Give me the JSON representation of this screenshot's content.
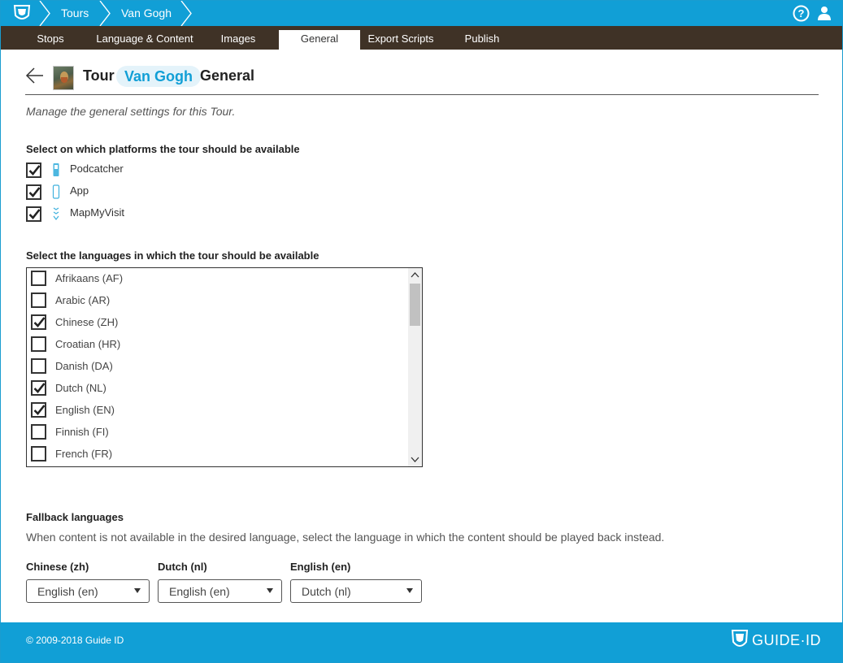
{
  "breadcrumb": {
    "items": [
      "Tours",
      "Van Gogh"
    ]
  },
  "nav": {
    "tabs": [
      {
        "label": "Stops"
      },
      {
        "label": "Language & Content"
      },
      {
        "label": "Images"
      },
      {
        "label": "General",
        "active": true
      },
      {
        "label": "Export Scripts"
      },
      {
        "label": "Publish"
      }
    ]
  },
  "header": {
    "title_prefix": "Tour",
    "tour_name": "Van Gogh",
    "title_suffix": "General",
    "subtitle": "Manage the general settings for this Tour."
  },
  "platforms": {
    "heading": "Select on which platforms the tour should be available",
    "items": [
      {
        "label": "Podcatcher",
        "checked": true,
        "icon": "podcatcher-icon"
      },
      {
        "label": "App",
        "checked": true,
        "icon": "phone-icon"
      },
      {
        "label": "MapMyVisit",
        "checked": true,
        "icon": "map-pin-icon"
      }
    ]
  },
  "languages": {
    "heading": "Select the languages in which the tour should be available",
    "items": [
      {
        "label": "Afrikaans (AF)",
        "checked": false
      },
      {
        "label": "Arabic (AR)",
        "checked": false
      },
      {
        "label": "Chinese (ZH)",
        "checked": true
      },
      {
        "label": "Croatian (HR)",
        "checked": false
      },
      {
        "label": "Danish (DA)",
        "checked": false
      },
      {
        "label": "Dutch (NL)",
        "checked": true
      },
      {
        "label": "English (EN)",
        "checked": true
      },
      {
        "label": "Finnish (FI)",
        "checked": false
      },
      {
        "label": "French (FR)",
        "checked": false
      }
    ]
  },
  "fallback": {
    "heading": "Fallback languages",
    "description": "When content is not available in the desired language, select the language in which the content should be played back instead.",
    "selects": [
      {
        "label": "Chinese (zh)",
        "value": "English (en)"
      },
      {
        "label": "Dutch (nl)",
        "value": "English (en)"
      },
      {
        "label": "English (en)",
        "value": "Dutch (nl)"
      }
    ]
  },
  "footer": {
    "copyright": "© 2009-2018 Guide ID",
    "brand": "GUIDE·ID"
  },
  "colors": {
    "accent": "#119fd6",
    "nav_bg": "#3f3226",
    "pill_bg": "#e4f3fa"
  }
}
